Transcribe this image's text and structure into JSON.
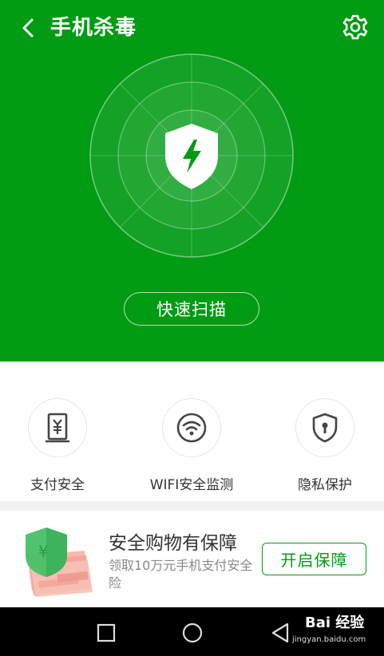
{
  "header": {
    "title": "手机杀毒",
    "back_icon": "chevron-left-icon",
    "settings_icon": "gear-icon"
  },
  "hero": {
    "background_color": "#019b14",
    "center_icon": "shield-lightning-icon",
    "scan_button_label": "快速扫描"
  },
  "features": [
    {
      "label": "支付安全",
      "icon": "yuan-receipt-icon"
    },
    {
      "label": "WIFI安全监测",
      "icon": "wifi-icon"
    },
    {
      "label": "隐私保护",
      "icon": "shield-keyhole-icon"
    }
  ],
  "promo": {
    "title": "安全购物有保障",
    "subtitle": "领取10万元手机支付安全险",
    "button_label": "开启保障",
    "accent_color": "#019b14",
    "illustration_icon": "shield-yuan-money-icon"
  },
  "navbar": {
    "back_icon": "triangle-back-icon",
    "home_icon": "circle-home-icon",
    "recents_icon": "square-recents-icon"
  },
  "watermark": {
    "brand": "Bai 经验",
    "url": "jingyan.baidu.com"
  }
}
